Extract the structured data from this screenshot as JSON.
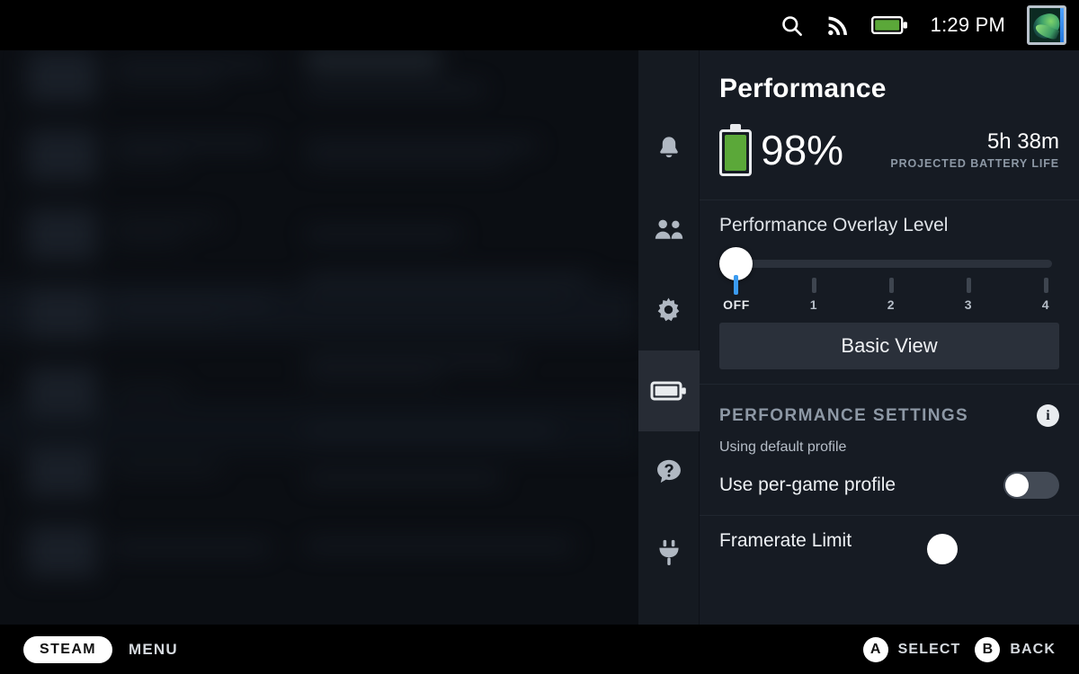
{
  "statusbar": {
    "search_icon": "search-icon",
    "wifi_icon": "wifi-icon",
    "battery_icon": "battery-icon",
    "time": "1:29 PM",
    "avatar_icon": "user-avatar"
  },
  "rail": {
    "items": [
      {
        "name": "notifications",
        "icon": "bell-icon",
        "active": false
      },
      {
        "name": "friends",
        "icon": "friends-icon",
        "active": false
      },
      {
        "name": "settings",
        "icon": "gear-icon",
        "active": false
      },
      {
        "name": "performance",
        "icon": "battery-icon",
        "active": true
      },
      {
        "name": "help",
        "icon": "help-icon",
        "active": false
      },
      {
        "name": "power",
        "icon": "power-plug-icon",
        "active": false
      }
    ]
  },
  "panel": {
    "title": "Performance",
    "battery": {
      "percent": "98%",
      "eta": "5h 38m",
      "eta_label": "PROJECTED BATTERY LIFE",
      "fill_color": "#5ba839"
    },
    "overlay": {
      "label": "Performance Overlay Level",
      "value": "OFF",
      "accent_color": "#3b9bf0",
      "ticks": [
        "OFF",
        "1",
        "2",
        "3",
        "4"
      ]
    },
    "view_button": "Basic View",
    "settings": {
      "heading": "PERFORMANCE SETTINGS",
      "info_icon": "info-icon",
      "subtitle": "Using default profile",
      "rows": [
        {
          "label": "Use per-game profile",
          "control": "toggle",
          "state": "off"
        },
        {
          "label": "Framerate Limit",
          "control": "slider"
        }
      ]
    }
  },
  "bottombar": {
    "steam_label": "STEAM",
    "menu_label": "MENU",
    "hints": [
      {
        "button": "A",
        "label": "SELECT"
      },
      {
        "button": "B",
        "label": "BACK"
      }
    ]
  }
}
